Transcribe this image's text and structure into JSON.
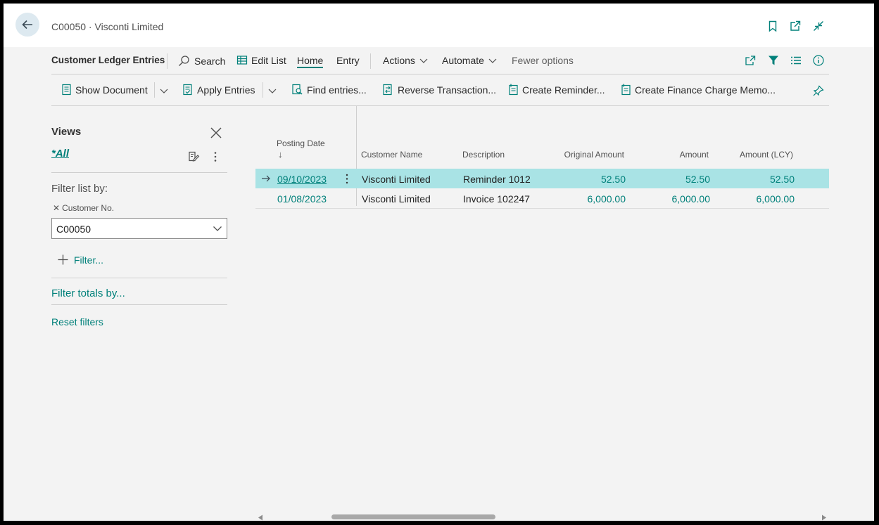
{
  "header": {
    "title": "C00050 · Visconti Limited"
  },
  "actionbar": {
    "page_name": "Customer Ledger Entries",
    "search": "Search",
    "edit_list": "Edit List",
    "home": "Home",
    "entry": "Entry",
    "actions": "Actions",
    "automate": "Automate",
    "fewer": "Fewer options"
  },
  "promoted": {
    "show_document": "Show Document",
    "apply_entries": "Apply Entries",
    "find_entries": "Find entries...",
    "reverse": "Reverse Transaction...",
    "reminder": "Create Reminder...",
    "finance": "Create Finance Charge Memo..."
  },
  "views": {
    "title": "Views",
    "all": "*All",
    "filter_by": "Filter list by:",
    "customer_no_label": "Customer No.",
    "customer_no_value": "C00050",
    "add_filter": "Filter...",
    "filter_totals": "Filter totals by...",
    "reset": "Reset filters"
  },
  "table": {
    "columns": {
      "posting_date": "Posting Date",
      "sort_arrow": "↓",
      "customer_name": "Customer Name",
      "description": "Description",
      "original_amount": "Original Amount",
      "amount": "Amount",
      "amount_lcy": "Amount (LCY)"
    },
    "rows": [
      {
        "posting_date": "09/10/2023",
        "customer_name": "Visconti Limited",
        "description": "Reminder 1012",
        "original_amount": "52.50",
        "amount": "52.50",
        "amount_lcy": "52.50",
        "selected": true
      },
      {
        "posting_date": "01/08/2023",
        "customer_name": "Visconti Limited",
        "description": "Invoice 102247",
        "original_amount": "6,000.00",
        "amount": "6,000.00",
        "amount_lcy": "6,000.00",
        "selected": false
      }
    ]
  },
  "colors": {
    "accent": "#00807a",
    "selected_row": "#a9e3e5"
  }
}
